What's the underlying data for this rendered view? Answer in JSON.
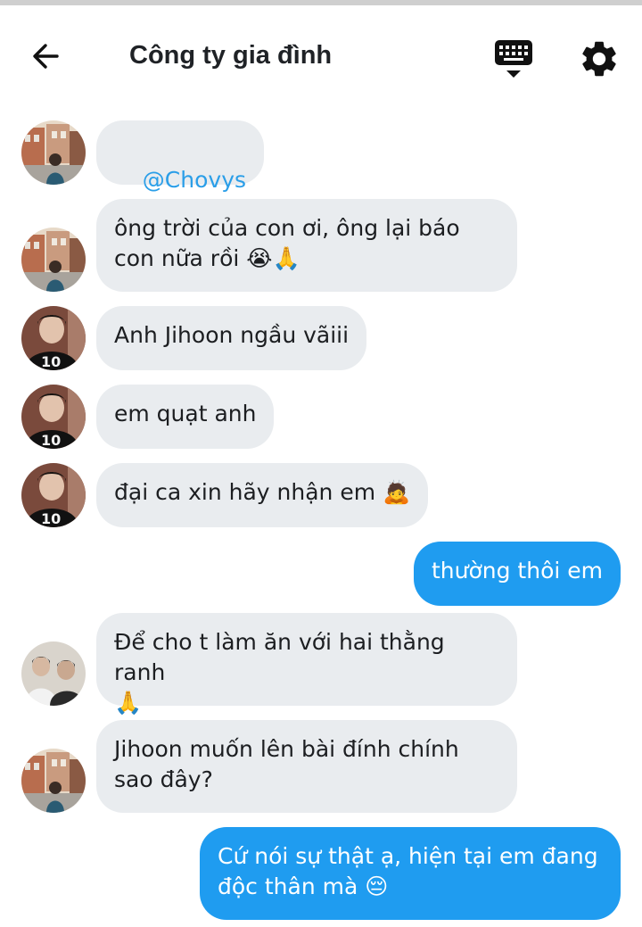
{
  "header": {
    "title": "Công ty gia đình"
  },
  "colors": {
    "incoming_bubble": "#e9ecef",
    "outgoing_bubble": "#1f9cf0",
    "mention": "#2a9ee8"
  },
  "messages": [
    {
      "from": "them",
      "avatar": "avatar-street-photo",
      "text": "@Chovys",
      "mention": true
    },
    {
      "from": "them",
      "avatar": "avatar-street-photo",
      "text": "ông trời của con ơi, ông lại báo\ncon nữa rồi 😭🙏"
    },
    {
      "from": "them",
      "avatar": "avatar-jersey-10",
      "text": "Anh Jihoon ngầu vãiii"
    },
    {
      "from": "them",
      "avatar": "avatar-jersey-10",
      "text": "em quạt anh"
    },
    {
      "from": "them",
      "avatar": "avatar-jersey-10",
      "text": "đại ca xin hãy nhận em 🙇"
    },
    {
      "from": "me",
      "text": "thường thôi em"
    },
    {
      "from": "them",
      "avatar": "avatar-group-photo",
      "text": "Để cho t làm ăn với hai thằng ranh\n🙏"
    },
    {
      "from": "them",
      "avatar": "avatar-street-photo",
      "text": "Jihoon muốn lên bài đính chính\nsao đây?"
    },
    {
      "from": "me",
      "text": "Cứ nói sự thật ạ, hiện tại em đang\nđộc thân mà 😔"
    }
  ]
}
